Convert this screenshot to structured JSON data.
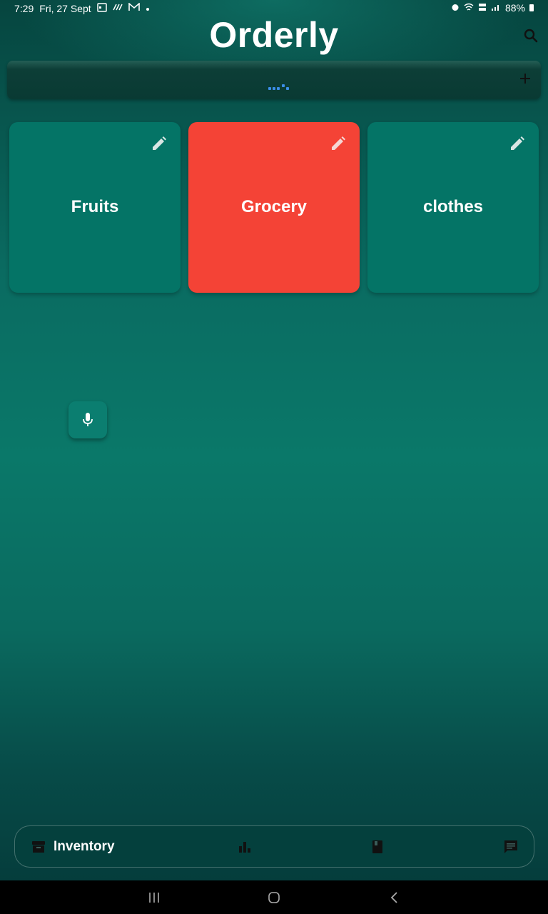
{
  "status_bar": {
    "time": "7:29",
    "date": "Fri, 27 Sept",
    "battery": "88%",
    "icons": [
      "calendar-icon",
      "signal-activity-icon",
      "gmail-icon",
      "notification-dot-icon",
      "alarm-icon",
      "wifi-icon",
      "volte-icon",
      "cell-signal-icon",
      "battery-icon"
    ]
  },
  "header": {
    "title": "Orderly",
    "search_icon": "search-icon"
  },
  "toolbar": {
    "add_icon": "plus-icon",
    "loading_indicator_color": "#3b8ee8"
  },
  "categories": [
    {
      "label": "Fruits",
      "color": "#047466",
      "selected": false
    },
    {
      "label": "Grocery",
      "color": "#f44336",
      "selected": true
    },
    {
      "label": "clothes",
      "color": "#047466",
      "selected": false
    }
  ],
  "mic_button": {
    "icon": "microphone-icon"
  },
  "bottom_nav": {
    "items": [
      {
        "label": "Inventory",
        "icon": "inventory-box-icon",
        "active": true
      },
      {
        "icon": "bar-chart-icon",
        "active": false
      },
      {
        "icon": "book-icon",
        "active": false
      },
      {
        "icon": "chat-icon",
        "active": false
      }
    ]
  },
  "system_nav": {
    "icons": [
      "recent-apps-icon",
      "home-icon",
      "back-icon"
    ]
  },
  "colors": {
    "accent_teal": "#047466",
    "selected_red": "#f44336",
    "background_dark": "#053d3c"
  }
}
